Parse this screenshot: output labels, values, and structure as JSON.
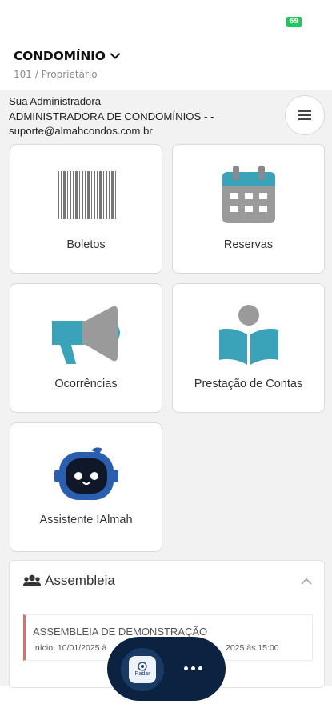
{
  "status_bar": {
    "battery": "69"
  },
  "header": {
    "title": "CONDOMÍNIO",
    "subtitle": "101 / Proprietário"
  },
  "administrator": {
    "heading": "Sua Administradora",
    "name": "ADMINISTRADORA DE CONDOMÍNIOS - -",
    "email": "suporte@almahcondos.com.br"
  },
  "cards": [
    {
      "label": "Boletos",
      "icon": "barcode-icon"
    },
    {
      "label": "Reservas",
      "icon": "calendar-icon"
    },
    {
      "label": "Ocorrências",
      "icon": "megaphone-icon"
    },
    {
      "label": "Prestação de Contas",
      "icon": "reading-person-icon"
    },
    {
      "label": "Assistente IAlmah",
      "icon": "robot-icon"
    }
  ],
  "assembly": {
    "title": "Assembleia",
    "item_name": "ASSEMBLEIA DE DEMONSTRAÇÃO",
    "start_text": "Início: 10/01/2025 à",
    "end_text": "2025 às 15:00"
  },
  "fab": {
    "radar_label": "Radar"
  },
  "colors": {
    "teal": "#3aa3b9",
    "gray_icon": "#9a9a9a",
    "navy": "#0b2340",
    "accent_red": "#e66a6a",
    "battery_green": "#1ec95b"
  }
}
